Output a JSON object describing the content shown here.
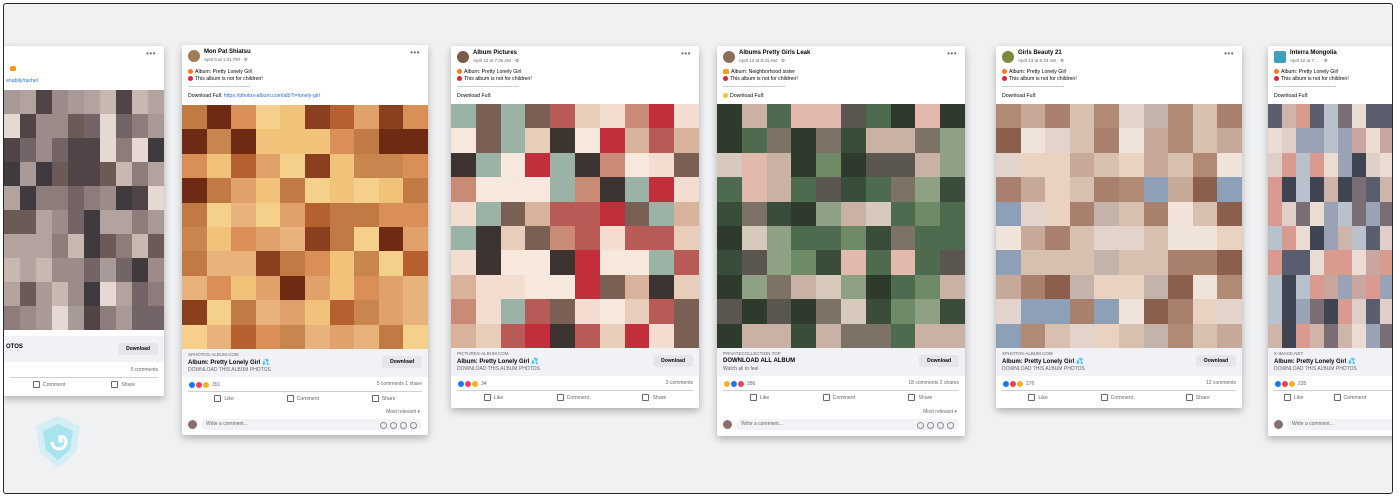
{
  "posts": [
    {
      "name": "",
      "meta": "",
      "line1": "",
      "line2": "",
      "download_link": "enablly/rachel",
      "domain": "",
      "link_title": "OTOS",
      "link_subtitle": "",
      "download_label": "Download",
      "reactions": "",
      "comments": "5 comments",
      "like": "",
      "comment": "Comment",
      "share": "Share"
    },
    {
      "name": "Mon Pat Shiatsu",
      "meta": "April 9 at 1:01 PM · ⚙",
      "line1": "Album: Pretty Lonely Girl",
      "line2": "This album is not for children!",
      "separator": "------------------------------------",
      "download_prefix": "Download Full:",
      "download_link": "https://photos-album.com/alb?t=lonely-girl",
      "domain": "XPHOTOS-ALBUM.COM",
      "link_title": "Album: Pretty Lonely Girl 💦",
      "link_subtitle": "DOWNLOAD THIS ALBUM PHOTOS",
      "download_label": "Download",
      "reactions": "351",
      "comments": "5 comments  1 share",
      "like": "Like",
      "comment": "Comment",
      "share": "Share",
      "most_relevant": "Most relevant ▾",
      "write_comment": "Write a comment..."
    },
    {
      "name": "Album Pictures",
      "meta": "April 12 at 7:36 AM · ⚙",
      "line1": "Album: Pretty Lonely Girl",
      "line2": "This album is not for children!",
      "separator": "------------------------------------",
      "download_prefix": "Download Full:",
      "download_link": "",
      "domain": "PICTURES-ALBUM.COM",
      "link_title": "Album: Pretty Lonely Girl 💦",
      "link_subtitle": "DOWNLOAD THIS ALBUM PHOTOS",
      "download_label": "Download",
      "reactions": "34",
      "comments": "3 comments",
      "like": "Like",
      "comment": "Comment",
      "share": "Share"
    },
    {
      "name": "Albums Pretty Girls Leak",
      "meta": "April 13 at 8:31 AM · ⚙",
      "line1": "Album: Neighborhood sister",
      "line2": "This album is not for children!",
      "separator": "------------------------------------",
      "download_prefix": "Download Full:",
      "download_link": "",
      "domain": "PRIVATECOLLECTION.TOP",
      "link_title": "DOWNLOAD ALL ALBUM",
      "link_subtitle": "Watch all to feel",
      "download_label": "Download",
      "reactions": "286",
      "comments": "18 comments  2 shares",
      "like": "Like",
      "comment": "Comment",
      "share": "Share",
      "most_relevant": "Most relevant ▾",
      "write_comment": "Write a comment..."
    },
    {
      "name": "Girls Beauty 21",
      "meta": "April 13 at 8:23 AM · ⚙",
      "line1": "Album: Pretty Lonely Girl",
      "line2": "This album is not for children!",
      "separator": "------------------------------------",
      "download_prefix": "Download Full:",
      "download_link": "",
      "domain": "XPHOTOS-ALBUM.COM",
      "link_title": "Album: Pretty Lonely Girl 💦",
      "link_subtitle": "DOWNLOAD THIS ALBUM PHOTOS",
      "download_label": "Download",
      "reactions": "276",
      "comments": "12 comments",
      "like": "Like",
      "comment": "Comment",
      "share": "Share"
    },
    {
      "name": "Interra Mongolia",
      "meta": "April 12 at 7:… · ⚙",
      "line1": "Album: Pretty Lonely Girl",
      "line2": "This album is not for children!",
      "separator": "------------------------------------",
      "download_prefix": "Download Full:",
      "download_link": "",
      "domain": "X-IMAGE.NET",
      "link_title": "Album: Pretty Lonely Girl 💦",
      "link_subtitle": "DOWNLOAD THIS ALBUM PHOTOS",
      "download_label": "",
      "reactions": "235",
      "comments": "",
      "like": "Like",
      "comment": "Comment",
      "share": "",
      "write_comment": "Write a comment..."
    }
  ],
  "colors": {
    "background": "#f0f1f3",
    "link_blue": "#216fdb",
    "watermark": "#9ee0ec"
  }
}
